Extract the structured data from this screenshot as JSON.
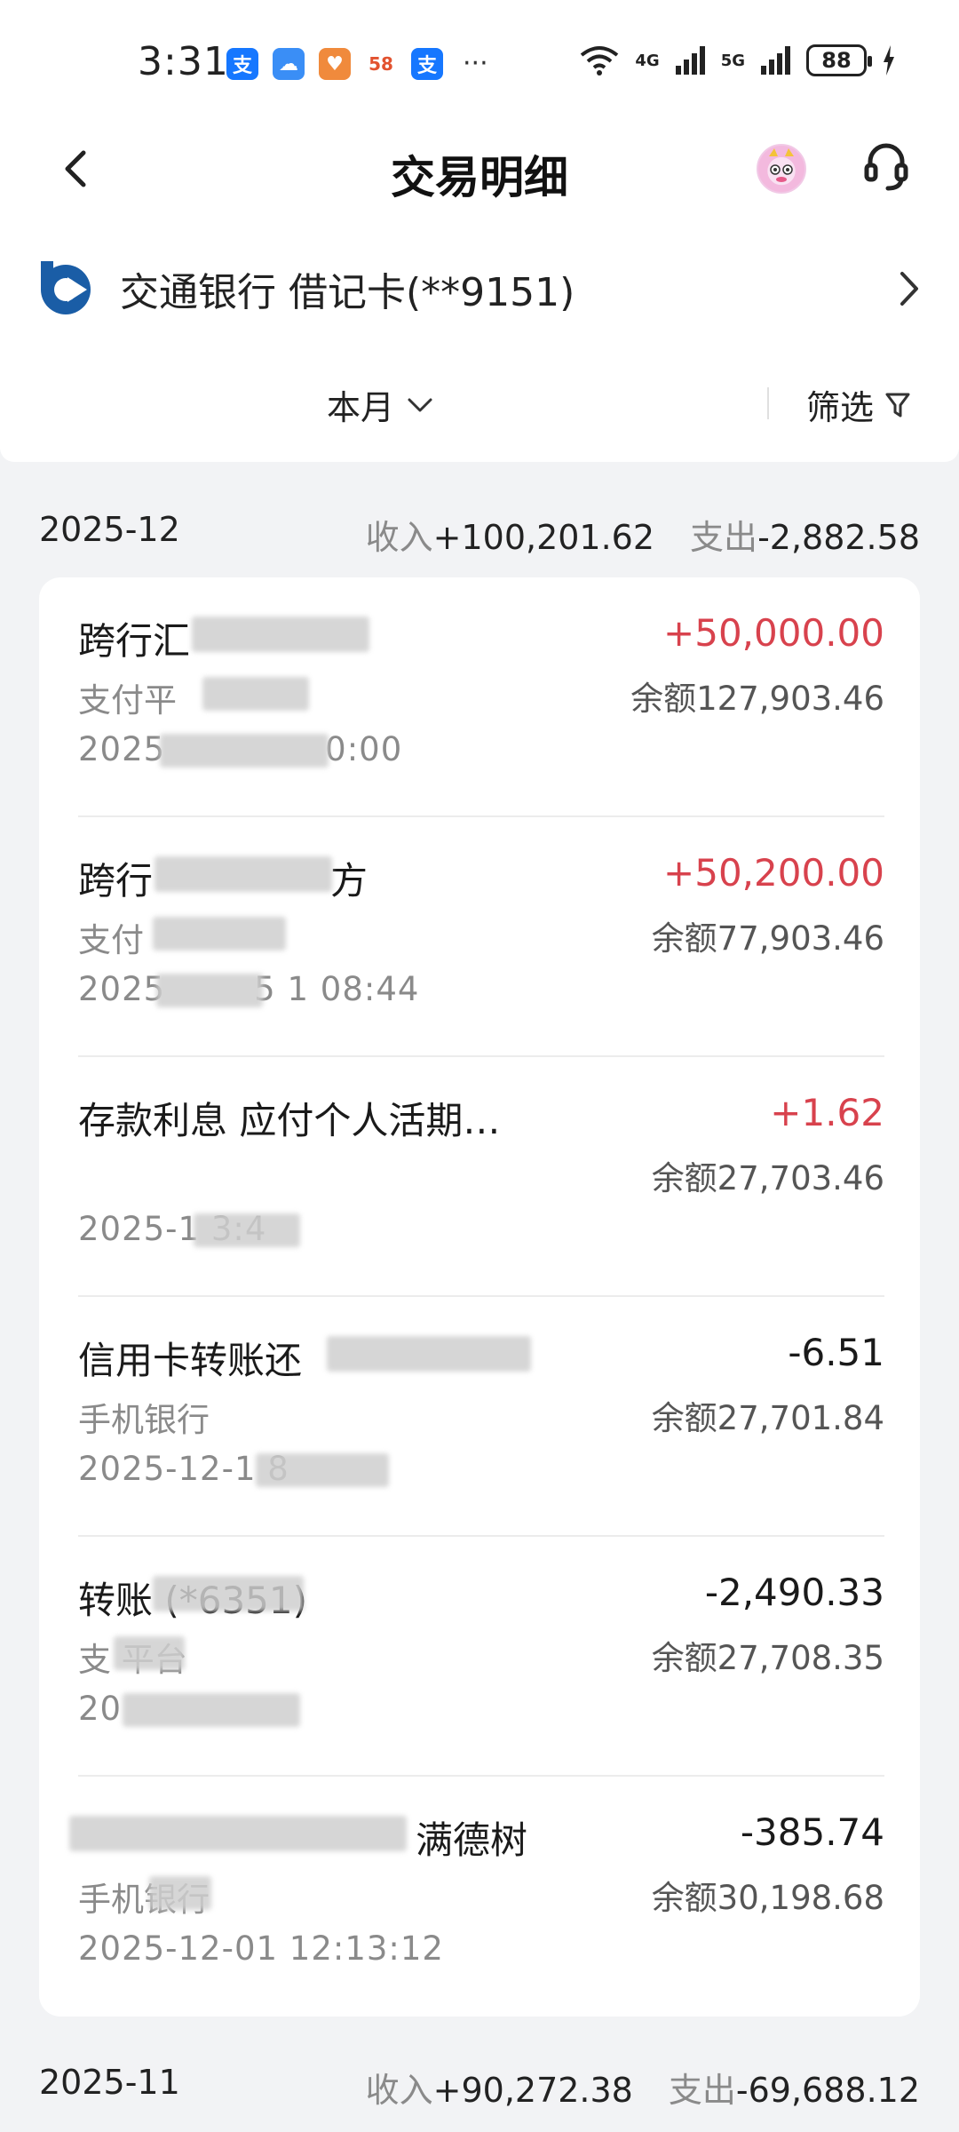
{
  "status_bar": {
    "time": "3:31",
    "apps": [
      {
        "icon": "alipay-icon",
        "glyph": "支",
        "color": "#1677ff"
      },
      {
        "icon": "cloud-icon",
        "glyph": "☁",
        "color": "#3a8ef6"
      },
      {
        "icon": "health-icon",
        "glyph": "♥",
        "color": "#f08a3c"
      },
      {
        "icon": "58-app-icon",
        "glyph": "58",
        "color": "#ffffff"
      },
      {
        "icon": "alipay-icon",
        "glyph": "支",
        "color": "#1677ff"
      }
    ],
    "more": "···",
    "net1": "4G",
    "net2": "5G",
    "battery": "88"
  },
  "header": {
    "title": "交易明细"
  },
  "account": {
    "name": "交通银行 借记卡(**9151)"
  },
  "filter": {
    "month": "本月",
    "screen": "筛选"
  },
  "summaries": [
    {
      "month": "2025-12",
      "income_label": "收入",
      "income": "+100,201.62",
      "expense_label": "支出",
      "expense": "-2,882.58"
    },
    {
      "month": "2025-11",
      "income_label": "收入",
      "income": "+90,272.38",
      "expense_label": "支出",
      "expense": "-69,688.12"
    }
  ],
  "transactions": [
    {
      "title": "跨行汇",
      "channel": "支付平",
      "time": "2025",
      "time_tail": "0:00",
      "amount": "+50,000.00",
      "balance": "余额127,903.46",
      "type": "income"
    },
    {
      "title": "跨行",
      "title_tail": "方",
      "channel": "支付",
      "time": "2025",
      "time_tail": "5 1 08:44",
      "amount": "+50,200.00",
      "balance": "余额77,903.46",
      "type": "income"
    },
    {
      "title": "存款利息 应付个人活期…",
      "channel": "",
      "time": "2025-1 3:4",
      "amount": "+1.62",
      "balance": "余额27,703.46",
      "type": "income"
    },
    {
      "title": "信用卡转账还",
      "channel": "手机银行",
      "time": "2025-12-1 8",
      "amount": "-6.51",
      "balance": "余额27,701.84",
      "type": "expense"
    },
    {
      "title": "转账 (*6351)",
      "channel": "支 平台",
      "time": "20",
      "amount": "-2,490.33",
      "balance": "余额27,708.35",
      "type": "expense"
    },
    {
      "title": "满德树",
      "channel": "手机银行",
      "time": "2025-12-01 12:13:12",
      "amount": "-385.74",
      "balance": "余额30,198.68",
      "type": "expense"
    }
  ],
  "colors": {
    "income": "#d8424d",
    "muted": "#8a8a8a",
    "background": "#f2f3f5",
    "bank_logo": "#1a5da6"
  }
}
